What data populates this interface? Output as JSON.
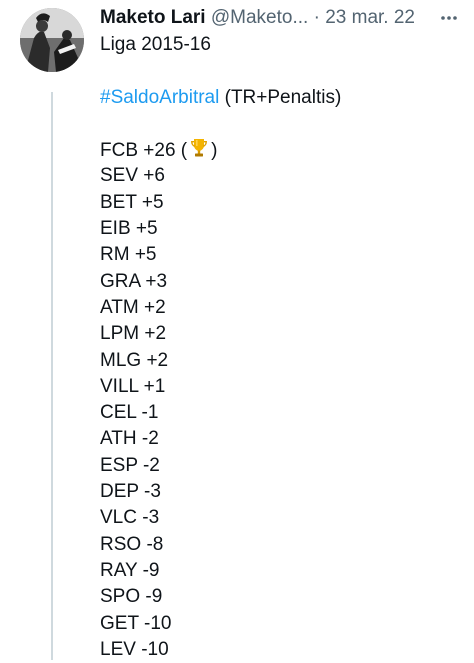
{
  "tweet": {
    "author_name": "Maketo Lari",
    "handle": "@Maketo...",
    "separator": "·",
    "date": "23 mar. 22",
    "more_icon": "more-horizontal-icon",
    "title_line": "Liga 2015-16",
    "hashtag": "#SaldoArbitral",
    "hashtag_suffix": " (TR+Penaltis)",
    "first_standing": {
      "text": "FCB +26 (",
      "icon": "trophy-icon",
      "close": ")"
    },
    "standings": [
      "SEV +6",
      "BET +5",
      "EIB +5",
      "RM +5",
      "GRA +3",
      "ATM +2",
      "LPM +2",
      "MLG +2",
      "VILL +1",
      "CEL -1",
      "ATH -2",
      "ESP -2",
      "DEP -3",
      "VLC -3",
      "RSO -8",
      "RAY -9",
      "SPO -9",
      "GET -10",
      "LEV -10"
    ]
  },
  "colors": {
    "text": "#0f1419",
    "secondary": "#536471",
    "link": "#1d9bf0",
    "thread_line": "#cfd9de",
    "trophy": "#f4b400"
  }
}
